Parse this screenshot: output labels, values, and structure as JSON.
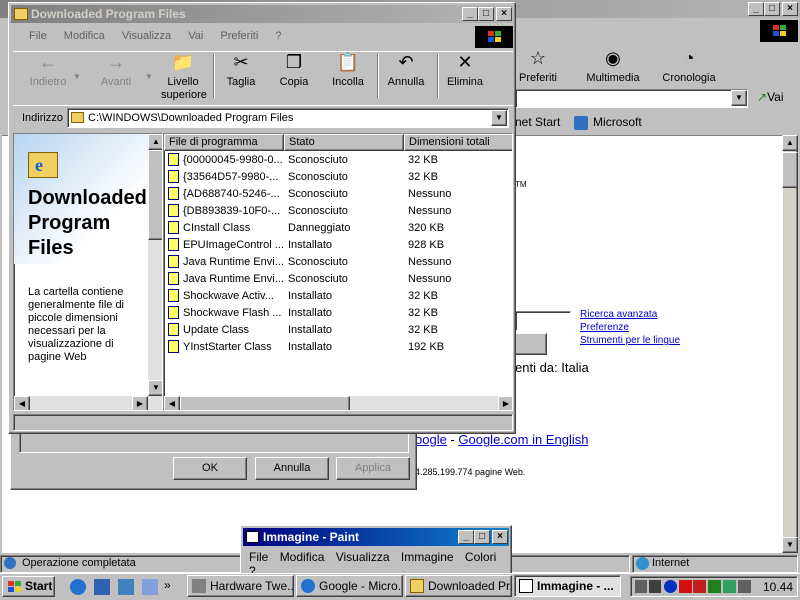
{
  "ie": {
    "title_buttons": [
      "_",
      "□",
      "×"
    ],
    "toolbar": [
      {
        "label": "Preferiti",
        "icon": "favorites-icon"
      },
      {
        "label": "Multimedia",
        "icon": "media-icon"
      },
      {
        "label": "Cronologia",
        "icon": "history-icon"
      }
    ],
    "go_label": "Vai",
    "links": [
      "net Start",
      "Microsoft"
    ],
    "content": {
      "search_links": [
        "Ricerca avanzata",
        "Preferenze",
        "Strumenti per le lingue"
      ],
      "pages_from": "enti da: Italia",
      "google_link": "oogle",
      "google_sep": " - ",
      "google_english": "Google.com in English",
      "pages_count": "4.285.199.774 pagine Web."
    },
    "status": "Operazione completata",
    "zone": "Internet"
  },
  "dialog": {
    "ok": "OK",
    "cancel": "Annulla",
    "apply": "Applica"
  },
  "explorer": {
    "title": "Downloaded Program Files",
    "menu": [
      "File",
      "Modifica",
      "Visualizza",
      "Vai",
      "Preferiti",
      "?"
    ],
    "toolbar": [
      {
        "label": "Indietro",
        "icon": "back-icon",
        "enabled": false
      },
      {
        "label": "Avanti",
        "icon": "forward-icon",
        "enabled": false
      },
      {
        "label": "Livello superiore",
        "icon": "up-folder-icon",
        "enabled": true
      },
      {
        "label": "Taglia",
        "icon": "cut-icon",
        "enabled": true
      },
      {
        "label": "Copia",
        "icon": "copy-icon",
        "enabled": true
      },
      {
        "label": "Incolla",
        "icon": "paste-icon",
        "enabled": true
      },
      {
        "label": "Annulla",
        "icon": "undo-icon",
        "enabled": true
      },
      {
        "label": "Elimina",
        "icon": "delete-icon",
        "enabled": true
      }
    ],
    "address_label": "Indirizzo",
    "address_value": "C:\\WINDOWS\\Downloaded Program Files",
    "panel_title": "Downloaded Program Files",
    "panel_text": "La cartella contiene generalmente file di piccole dimensioni necessari per la visualizzazione di pagine Web",
    "columns": [
      "File di programma",
      "Stato",
      "Dimensioni totali"
    ],
    "rows": [
      {
        "name": "{00000045-9980-0...",
        "status": "Sconosciuto",
        "size": "32 KB"
      },
      {
        "name": "{33564D57-9980-...",
        "status": "Sconosciuto",
        "size": "32 KB"
      },
      {
        "name": "{AD688740-5246-...",
        "status": "Sconosciuto",
        "size": "Nessuno"
      },
      {
        "name": "{DB893839-10F0-...",
        "status": "Sconosciuto",
        "size": "Nessuno"
      },
      {
        "name": "CInstall Class",
        "status": "Danneggiato",
        "size": "320 KB"
      },
      {
        "name": "EPUImageControl ...",
        "status": "Installato",
        "size": "928 KB"
      },
      {
        "name": "Java Runtime Envi...",
        "status": "Sconosciuto",
        "size": "Nessuno"
      },
      {
        "name": "Java Runtime Envi...",
        "status": "Sconosciuto",
        "size": "Nessuno"
      },
      {
        "name": "Shockwave Activ...",
        "status": "Installato",
        "size": "32 KB"
      },
      {
        "name": "Shockwave Flash ...",
        "status": "Installato",
        "size": "32 KB"
      },
      {
        "name": "Update Class",
        "status": "Installato",
        "size": "32 KB"
      },
      {
        "name": "YInstStarter Class",
        "status": "Installato",
        "size": "192 KB"
      }
    ]
  },
  "paint": {
    "title": "Immagine - Paint",
    "menu": [
      "File",
      "Modifica",
      "Visualizza",
      "Immagine",
      "Colori",
      "?"
    ]
  },
  "taskbar": {
    "start": "Start",
    "tasks": [
      {
        "label": "Hardware Twe...",
        "active": false
      },
      {
        "label": "Google - Micro...",
        "active": false
      },
      {
        "label": "Downloaded Pr...",
        "active": false
      },
      {
        "label": "Immagine - ...",
        "active": true
      }
    ],
    "clock": "10.44"
  }
}
